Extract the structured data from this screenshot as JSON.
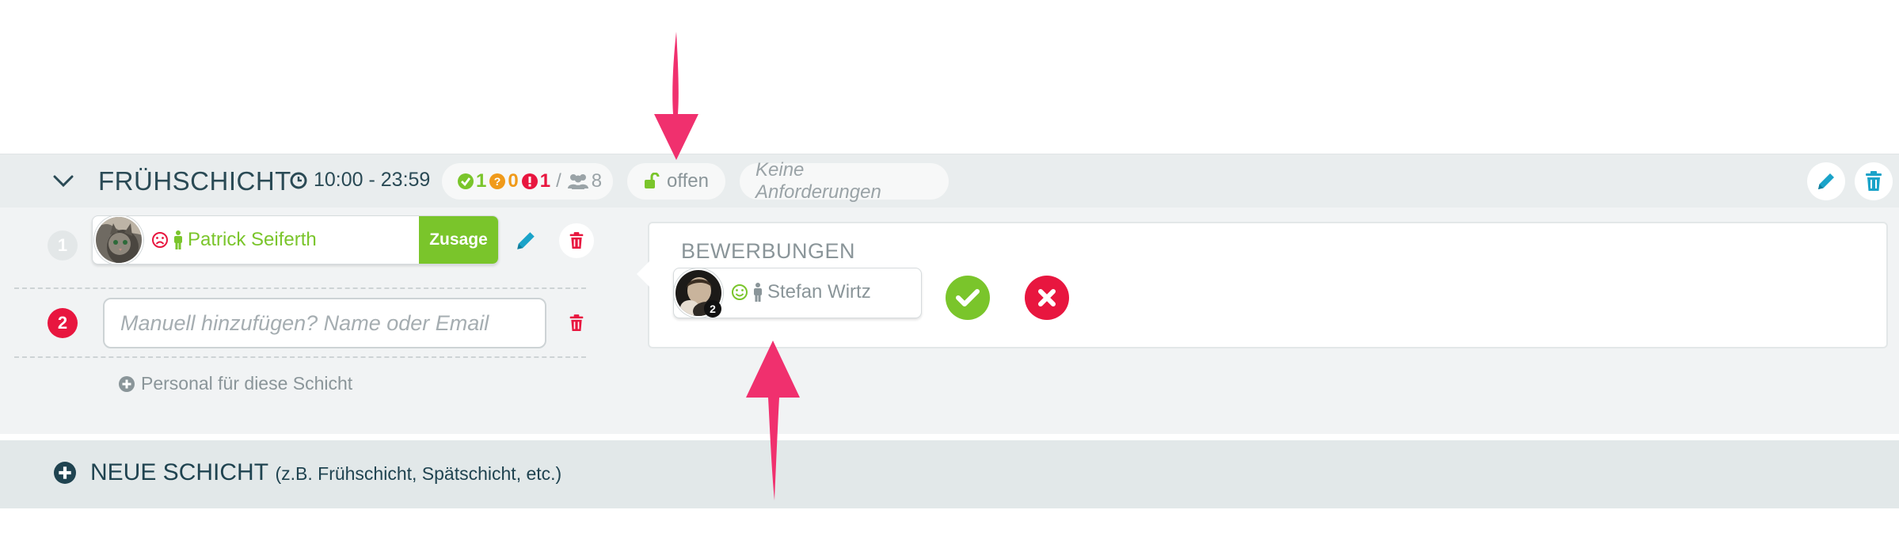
{
  "shift": {
    "title": "FRÜHSCHICHT",
    "time": "10:00 - 23:59",
    "stats": {
      "accepted": "1",
      "pending": "0",
      "missing": "1",
      "separator": "/",
      "total": "8"
    },
    "status": "offen",
    "requirements": "Keine Anforderungen"
  },
  "slots": [
    {
      "number": "1",
      "name": "Patrick Seiferth",
      "action": "Zusage"
    },
    {
      "number": "2",
      "placeholder": "Manuell hinzufügen? Name oder Email"
    }
  ],
  "add_staff_label": "Personal für diese Schicht",
  "applications": {
    "title": "BEWERBUNGEN",
    "applicant_name": "Stefan Wirtz",
    "applicant_badge": "2"
  },
  "new_shift": {
    "label": "NEUE SCHICHT",
    "hint": "(z.B. Frühschicht, Spätschicht, etc.)"
  },
  "colors": {
    "green": "#7ac52b",
    "orange": "#f09a1a",
    "red": "#e8163f",
    "teal": "#1aa3c9",
    "dark": "#2a4a55",
    "arrow": "#f0306e"
  }
}
